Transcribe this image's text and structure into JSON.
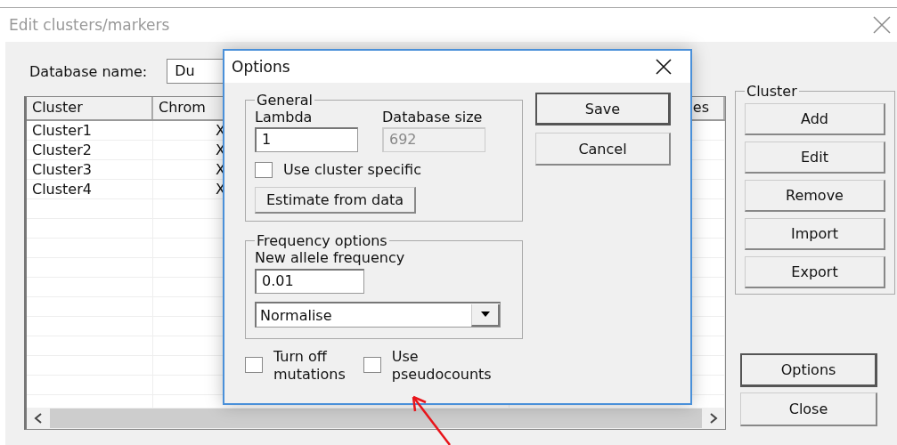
{
  "window": {
    "title": "Edit clusters/markers"
  },
  "database": {
    "label": "Database name:",
    "value": "Du"
  },
  "table": {
    "columns": [
      "Cluster",
      "Chrom",
      "es"
    ],
    "rows": [
      [
        "Cluster1",
        "X"
      ],
      [
        "Cluster2",
        "X"
      ],
      [
        "Cluster3",
        "X"
      ],
      [
        "Cluster4",
        "X"
      ]
    ]
  },
  "cluster_group": {
    "title": "Cluster",
    "buttons": [
      "Add",
      "Edit",
      "Remove",
      "Import",
      "Export"
    ]
  },
  "buttons": [
    {
      "label": "Options",
      "default": true
    },
    {
      "label": "Close",
      "default": false
    }
  ],
  "dialog": {
    "title": "Options",
    "general": {
      "title": "General",
      "lambda_label": "Lambda",
      "lambda_value": "1",
      "db_size_label": "Database size",
      "db_size_value": "692",
      "db_size_disabled": true,
      "cluster_specific": {
        "label": "Use cluster specific",
        "checked": false
      },
      "estimate_button": "Estimate from data"
    },
    "frequency": {
      "title": "Frequency options",
      "allele_label": "New allele frequency",
      "allele_value": "0.01",
      "method": "Normalise"
    },
    "checkboxes": [
      {
        "label": "Turn off\nmutations",
        "checked": false
      },
      {
        "label": "Use\npseudocounts",
        "checked": false
      }
    ],
    "buttons": [
      {
        "label": "Save",
        "default": true
      },
      {
        "label": "Cancel",
        "default": false
      }
    ]
  }
}
